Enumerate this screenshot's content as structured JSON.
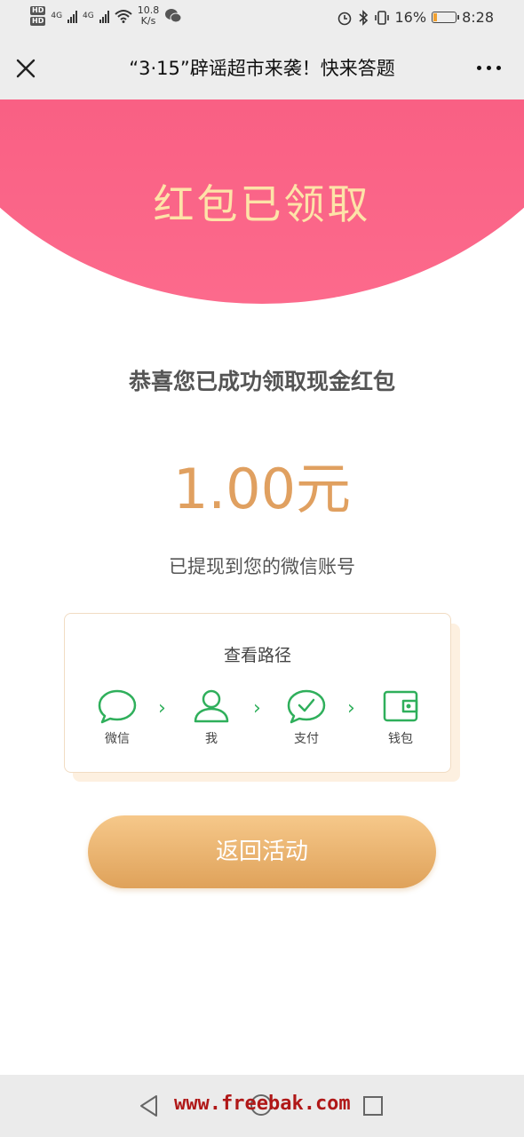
{
  "status_bar": {
    "hd1": "HD",
    "hd2": "HD",
    "net1": "4G",
    "net2": "4G",
    "speed_value": "10.8",
    "speed_unit": "K/s",
    "battery_pct": "16%",
    "battery_level": 0.16,
    "time": "8:28"
  },
  "title_bar": {
    "title": "“3·15”辟谣超市来袭！快来答题"
  },
  "hero": {
    "title": "红包已领取"
  },
  "main": {
    "congrats": "恭喜您已成功领取现金红包",
    "amount": "1.00元",
    "note": "已提现到您的微信账号"
  },
  "path_card": {
    "title": "查看路径",
    "steps": [
      {
        "icon": "chat-bubble-icon",
        "label": "微信"
      },
      {
        "icon": "person-icon",
        "label": "我"
      },
      {
        "icon": "check-bubble-icon",
        "label": "支付"
      },
      {
        "icon": "wallet-icon",
        "label": "钱包"
      }
    ],
    "arrow": "›",
    "accent_color": "#2faf5b"
  },
  "actions": {
    "back_label": "返回活动"
  },
  "nav_bar": {
    "watermark": "www.freebak.com"
  },
  "colors": {
    "hero_gradient_top": "#f24a72",
    "hero_gradient_bottom": "#fc6a8c",
    "hero_title": "#fde3a8",
    "amount": "#e0a060",
    "button_top": "#f6c88a",
    "button_bottom": "#dfa25a"
  }
}
